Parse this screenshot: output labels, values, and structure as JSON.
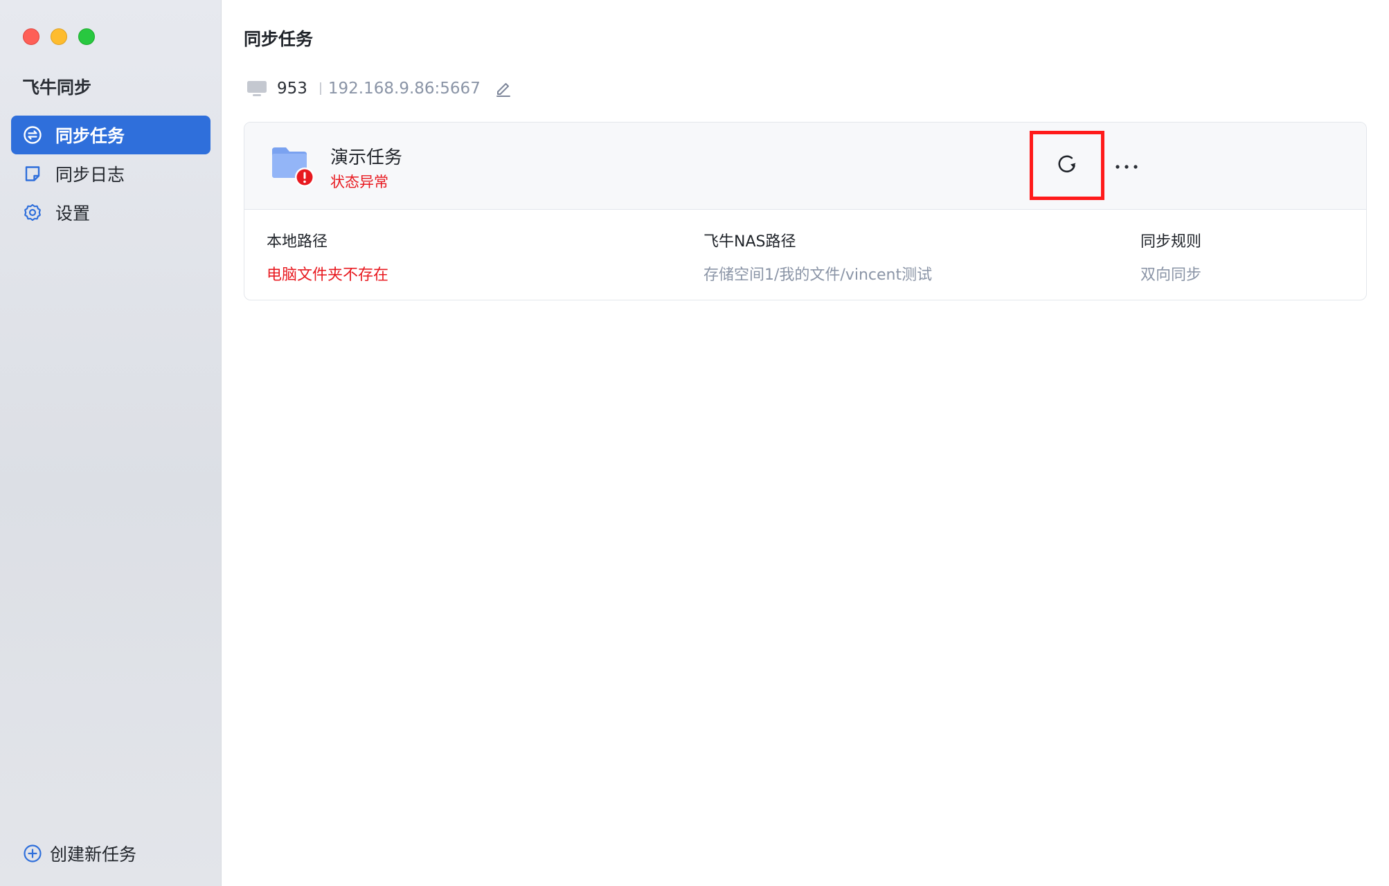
{
  "app": {
    "title": "飞牛同步"
  },
  "sidebar": {
    "items": [
      {
        "label": "同步任务",
        "icon": "sync-task-icon",
        "active": true
      },
      {
        "label": "同步日志",
        "icon": "log-icon",
        "active": false
      },
      {
        "label": "设置",
        "icon": "gear-icon",
        "active": false
      }
    ],
    "create_label": "创建新任务"
  },
  "main": {
    "title": "同步任务",
    "server": {
      "name": "953",
      "address": "192.168.9.86:5667"
    },
    "task": {
      "name": "演示任务",
      "status": "状态异常",
      "columns": [
        {
          "label": "本地路径",
          "value": "电脑文件夹不存在"
        },
        {
          "label": "飞牛NAS路径",
          "value": "存储空间1/我的文件/vincent测试"
        },
        {
          "label": "同步规则",
          "value": "双向同步"
        }
      ]
    }
  },
  "colors": {
    "accent": "#2f6fdb",
    "error": "#e8191f",
    "highlight": "#ff1a1a"
  }
}
